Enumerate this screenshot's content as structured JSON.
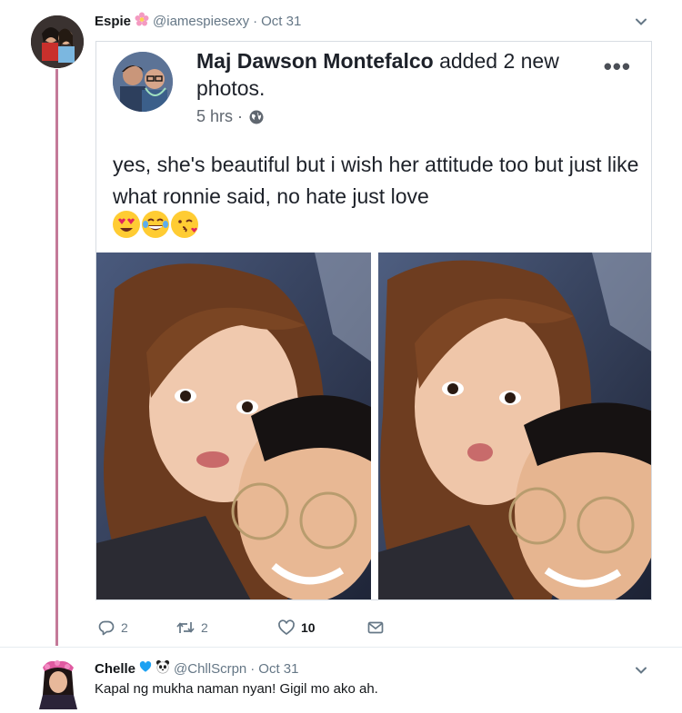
{
  "tweet": {
    "name": "Espie",
    "handle": "@iamespiesexy",
    "separator": "·",
    "date": "Oct 31",
    "embedded_post": {
      "author": "Maj Dawson Montefalco",
      "action": "added 2 new photos.",
      "time": "5 hrs ·",
      "more_label": "•••",
      "text": "yes, she's beautiful but i wish her attitude too but just like what ronnie said, no hate just love"
    },
    "actions": {
      "replies": "2",
      "retweets": "2",
      "likes": "10"
    }
  },
  "reply": {
    "name": "Chelle",
    "handle": "@ChllScrpn",
    "separator": "·",
    "date": "Oct 31",
    "text": "Kapal ng mukha naman nyan! Gigil mo ako ah."
  },
  "colors": {
    "thread_line": "#c47a99",
    "muted": "#657786",
    "name": "#14171a",
    "heart_badge": "#1da1f2"
  }
}
